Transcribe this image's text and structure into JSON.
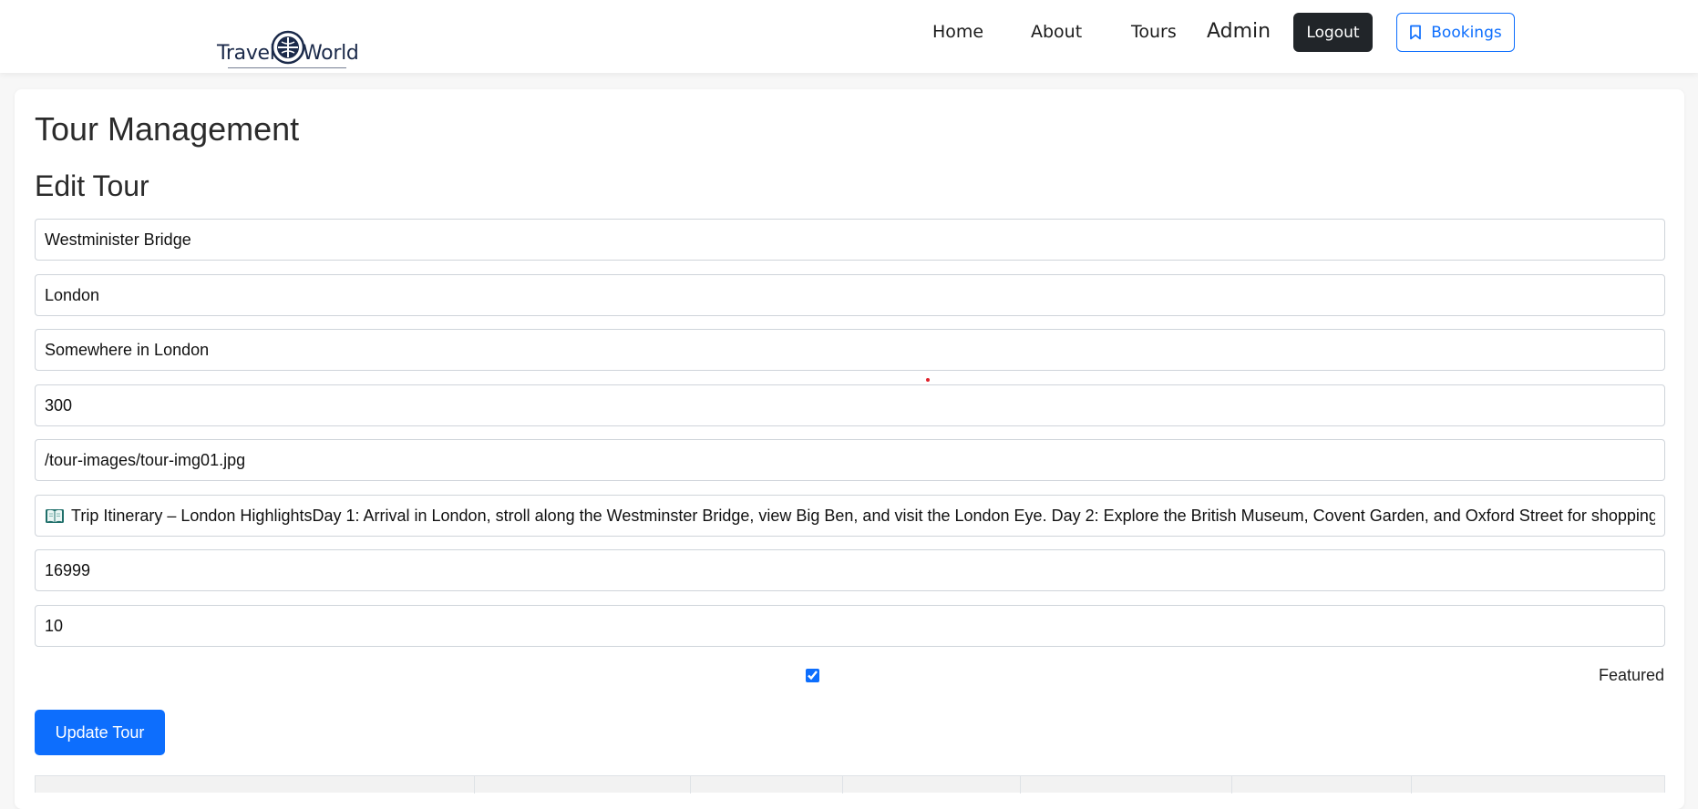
{
  "header": {
    "logo": {
      "left_text": "Travel",
      "right_text": "World"
    },
    "nav": {
      "home": "Home",
      "about": "About",
      "tours": "Tours",
      "admin": "Admin"
    },
    "logout_label": "Logout",
    "bookings_label": "Bookings",
    "brand_color": "#0d6efd"
  },
  "main": {
    "page_title": "Tour Management",
    "section_title": "Edit Tour",
    "form": {
      "title": "Westminister Bridge",
      "city": "London",
      "address": "Somewhere in London",
      "distance": "300",
      "photo": "/tour-images/tour-img01.jpg",
      "itinerary": "Trip Itinerary – London HighlightsDay 1: Arrival in London, stroll along the Westminster Bridge, view Big Ben, and visit the London Eye. Day 2: Explore the British Museum, Covent Garden, and Oxford Street for shopping",
      "itinerary_icon": "open-book-icon",
      "price": "16999",
      "max_group_size": "10",
      "featured_checked": true,
      "featured_label": "Featured"
    },
    "update_button_label": "Update Tour"
  }
}
